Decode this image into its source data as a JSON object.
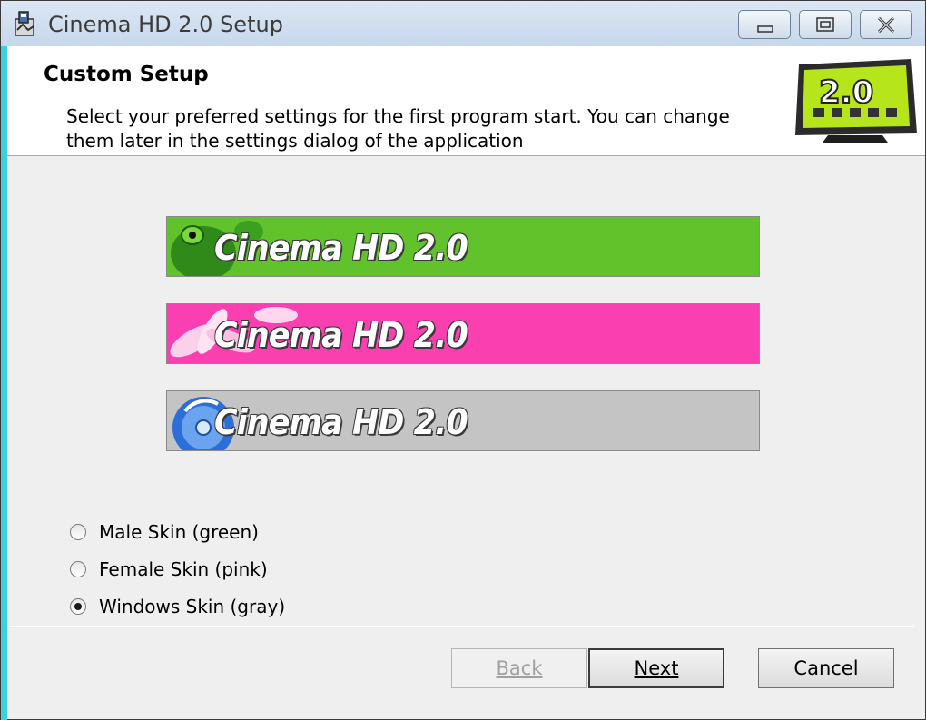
{
  "window": {
    "title": "Cinema HD 2.0 Setup",
    "icon": "installer-icon",
    "controls": [
      "minimize-icon",
      "maximize-icon",
      "close-icon"
    ]
  },
  "header": {
    "title": "Custom Setup",
    "description": "Select your preferred settings for the first program start. You can change them later in the settings dialog of the application",
    "logo_text": "2.0"
  },
  "banners": [
    {
      "text": "Cinema HD 2.0",
      "color": "#62c22c",
      "decoration": "frog"
    },
    {
      "text": "Cinema HD 2.0",
      "color": "#fa3fb0",
      "decoration": "lotus-flower"
    },
    {
      "text": "Cinema HD 2.0",
      "color": "#c4c4c4",
      "decoration": "disc"
    }
  ],
  "skin_options": [
    {
      "label": "Male Skin (green)",
      "selected": false
    },
    {
      "label": "Female Skin (pink)",
      "selected": false
    },
    {
      "label": "Windows Skin (gray)",
      "selected": true
    }
  ],
  "buttons": {
    "back": {
      "label": "Back",
      "enabled": false
    },
    "next": {
      "label": "Next",
      "enabled": true,
      "default": true
    },
    "cancel": {
      "label": "Cancel",
      "enabled": true
    }
  }
}
